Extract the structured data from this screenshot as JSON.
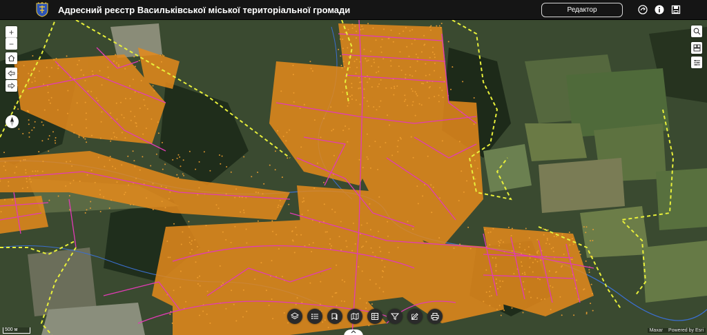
{
  "header": {
    "title": "Адресний реєстр Васильківської міської територіальної громади",
    "editor_label": "Редактор",
    "icons": [
      "share-icon",
      "info-icon",
      "save-icon"
    ]
  },
  "map_controls": {
    "zoom_in": "+",
    "zoom_out": "−",
    "home_icon": "home-icon",
    "back_icon": "arrow-left-icon",
    "forward_icon": "arrow-right-icon",
    "compass_icon": "compass-icon"
  },
  "right_tools": [
    "search-icon",
    "basemap-gallery-icon",
    "layer-list-icon"
  ],
  "bottom_toolbar": [
    "layers-icon",
    "legend-icon",
    "bookmarks-icon",
    "basemap-icon",
    "table-icon",
    "filter-icon",
    "edit-icon",
    "print-icon"
  ],
  "scale": {
    "label": "500 м"
  },
  "attribution": {
    "left": "Maxar",
    "right": "Powered by Esri"
  },
  "colors": {
    "header_bg": "#151515",
    "boundary": "#e8f03a",
    "roads": "#e23bb6",
    "addresses": "#e58a1c",
    "rivers": "#3b6fd0"
  }
}
